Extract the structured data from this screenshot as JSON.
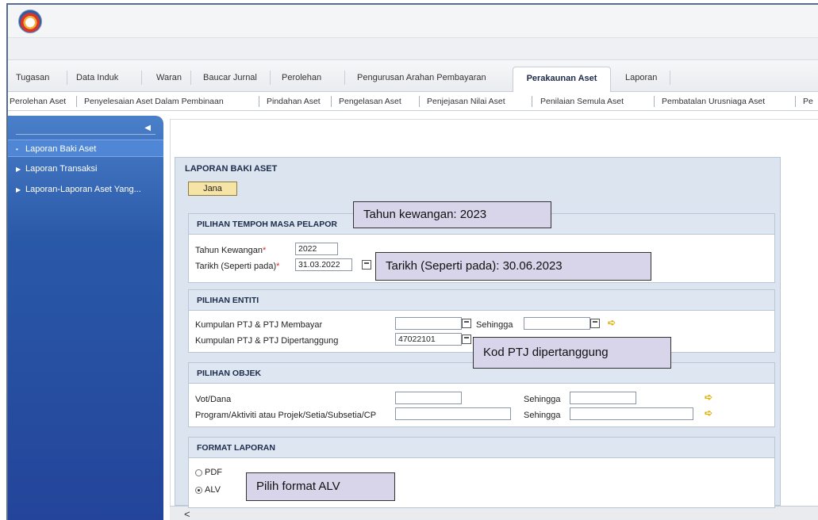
{
  "header_tabs": [
    "Tugasan",
    "Data Induk",
    "Waran",
    "Baucar Jurnal",
    "Perolehan",
    "Pengurusan Arahan Pembayaran",
    "Perakaunan Aset",
    "Laporan"
  ],
  "sub_tabs": [
    "Perolehan Aset",
    "Penyelesaian Aset Dalam Pembinaan",
    "Pindahan Aset",
    "Pengelasan Aset",
    "Penjejasan Nilai Aset",
    "Penilaian Semula Aset",
    "Pembatalan Urusniaga Aset",
    "Pe"
  ],
  "sidebar": {
    "items": [
      {
        "label": "Laporan Baki Aset",
        "active": true
      },
      {
        "label": "Laporan Transaksi"
      },
      {
        "label": "Laporan-Laporan Aset Yang..."
      }
    ]
  },
  "panel": {
    "title": "LAPORAN BAKI ASET",
    "jana_label": "Jana",
    "tempoh": {
      "header": "PILIHAN TEMPOH MASA PELAPOR",
      "tahun_label": "Tahun Kewangan",
      "tahun_value": "2022",
      "tarikh_label": "Tarikh (Seperti pada)",
      "tarikh_value": "31.03.2022",
      "required_mark": "*"
    },
    "entiti": {
      "header": "PILIHAN ENTITI",
      "membayar_label": "Kumpulan PTJ & PTJ Membayar",
      "membayar_value": "",
      "sehingga_label": "Sehingga",
      "sehingga_value": "",
      "dipertanggung_label": "Kumpulan PTJ & PTJ Dipertanggung",
      "dipertanggung_value": "47022101"
    },
    "objek": {
      "header": "PILIHAN OBJEK",
      "vot_label": "Vot/Dana",
      "program_label": "Program/Aktiviti atau Projek/Setia/Subsetia/CP",
      "sehingga_label": "Sehingga"
    },
    "format": {
      "header": "FORMAT LAPORAN",
      "pdf_label": "PDF",
      "alv_label": "ALV",
      "selected": "ALV"
    }
  },
  "callouts": {
    "tahun": "Tahun kewangan: 2023",
    "tarikh": "Tarikh (Seperti pada): 30.06.2023",
    "kod": "Kod PTJ dipertanggung",
    "alv": "Pilih format ALV"
  },
  "colors": {
    "sidebar": "#2a59a8",
    "sidebar_active": "#4f86d6",
    "jana_button": "#f5e4a6",
    "callout_bg": "#d8d4ea",
    "panel_bg": "#dbe4ef"
  },
  "icons": {
    "go": "arrow-right-icon",
    "calendar": "calendar-icon",
    "collapse": "chevron-left-icon"
  }
}
